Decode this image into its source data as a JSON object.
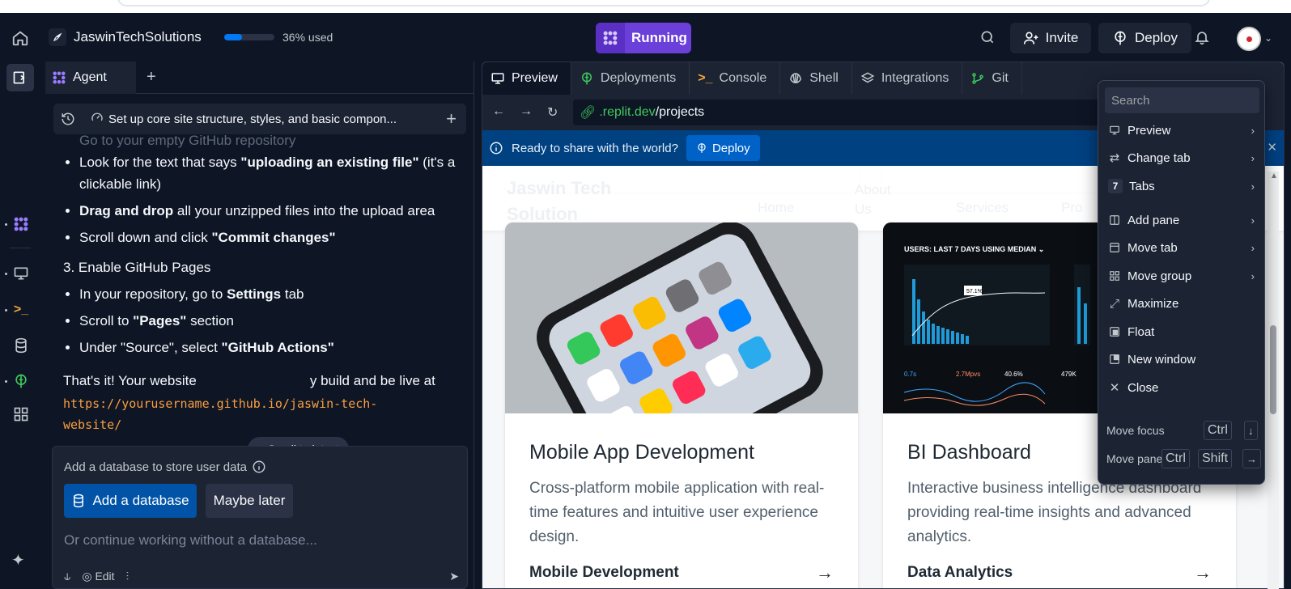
{
  "topbar": {
    "app_name": "JaswinTechSolutions",
    "usage_fraction": 0.36,
    "usage_text": "36% used",
    "run_label": "Running",
    "invite_label": "Invite",
    "deploy_label": "Deploy"
  },
  "agent": {
    "tab_label": "Agent",
    "task_title": "Set up core site structure, styles, and basic compon...",
    "chat": {
      "ghost_line": "Go to your empty GitHub repository",
      "bullets_a": [
        {
          "pre": "Look for the text that says ",
          "bold": "\"uploading an existing file\"",
          "post": " (it's a clickable link)"
        },
        {
          "pre": "",
          "bold": "Drag and drop",
          "post": " all your unzipped files into the upload area"
        },
        {
          "pre": "Scroll down and click ",
          "bold": "\"Commit changes\"",
          "post": ""
        }
      ],
      "step3": "3. Enable GitHub Pages",
      "bullets_b": [
        {
          "pre": "In your repository, go to ",
          "bold": "Settings",
          "post": " tab"
        },
        {
          "pre": "Scroll to ",
          "bold": "\"Pages\"",
          "post": " section"
        },
        {
          "pre": "Under \"Source\", select ",
          "bold": "\"GitHub Actions\"",
          "post": ""
        }
      ],
      "closing_pre": "That's it! Your website",
      "closing_post": "y build and be live at",
      "url": "https://yourusername.github.io/jaswin-tech-website/"
    },
    "scroll_latest": "Scroll to latest",
    "db_card": {
      "title": "Add a database to store user data",
      "add_label": "Add a database",
      "later_label": "Maybe later",
      "input_placeholder": "Or continue working without a database...",
      "edit_label": "Edit"
    }
  },
  "workspace": {
    "tabs": [
      {
        "label": "Preview",
        "icon": "monitor-icon"
      },
      {
        "label": "Deployments",
        "icon": "deploy-icon"
      },
      {
        "label": "Console",
        "icon": "terminal-icon"
      },
      {
        "label": "Shell",
        "icon": "shell-icon"
      },
      {
        "label": "Integrations",
        "icon": "layers-icon"
      },
      {
        "label": "Git",
        "icon": "git-icon"
      }
    ],
    "url_host": ".replit.dev",
    "url_path": "/projects",
    "banner_text": "Ready to share with the world?",
    "banner_deploy": "Deploy",
    "site": {
      "logo_line1": "Jaswin Tech",
      "logo_line2": "Solution",
      "nav": [
        "Home",
        "About Us",
        "Services",
        "Pro"
      ],
      "cards": [
        {
          "title": "Mobile App Development",
          "description": "Cross-platform mobile application with real-time features and intuitive user experience design.",
          "footer": "Mobile Development",
          "image": "smartphone-photo"
        },
        {
          "title": "BI Dashboard",
          "description": "Interactive business intelligence dashboard providing real-time insights and advanced analytics.",
          "footer": "Data Analytics",
          "image": "dashboard-photo"
        }
      ]
    }
  },
  "menu": {
    "search_placeholder": "Search",
    "items": [
      {
        "label": "Preview",
        "icon": "monitor-icon",
        "submenu": true
      },
      {
        "label": "Change tab",
        "icon": "swap-icon",
        "submenu": true
      },
      {
        "label": "Tabs",
        "icon": "badge-7",
        "badge": "7",
        "submenu": true
      },
      {
        "label": "Add pane",
        "icon": "split-icon",
        "submenu": true
      },
      {
        "label": "Move tab",
        "icon": "move-tab-icon",
        "submenu": true
      },
      {
        "label": "Move group",
        "icon": "grid-icon",
        "submenu": true
      },
      {
        "label": "Maximize",
        "icon": "maximize-icon",
        "submenu": false
      },
      {
        "label": "Float",
        "icon": "float-icon",
        "submenu": false
      },
      {
        "label": "New window",
        "icon": "new-window-icon",
        "submenu": false
      },
      {
        "label": "Close",
        "icon": "close-icon",
        "submenu": false
      }
    ],
    "shortcuts": [
      {
        "label": "Move focus",
        "keys": [
          "Ctrl",
          "↓"
        ]
      },
      {
        "label": "Move pane",
        "keys": [
          "Ctrl",
          "Shift",
          "→"
        ]
      }
    ]
  },
  "colors": {
    "bg": "#0e1525",
    "surface": "#1c2333",
    "accent_purple": "#6b3fd9",
    "accent_blue": "#0079f2",
    "banner": "#004182"
  }
}
